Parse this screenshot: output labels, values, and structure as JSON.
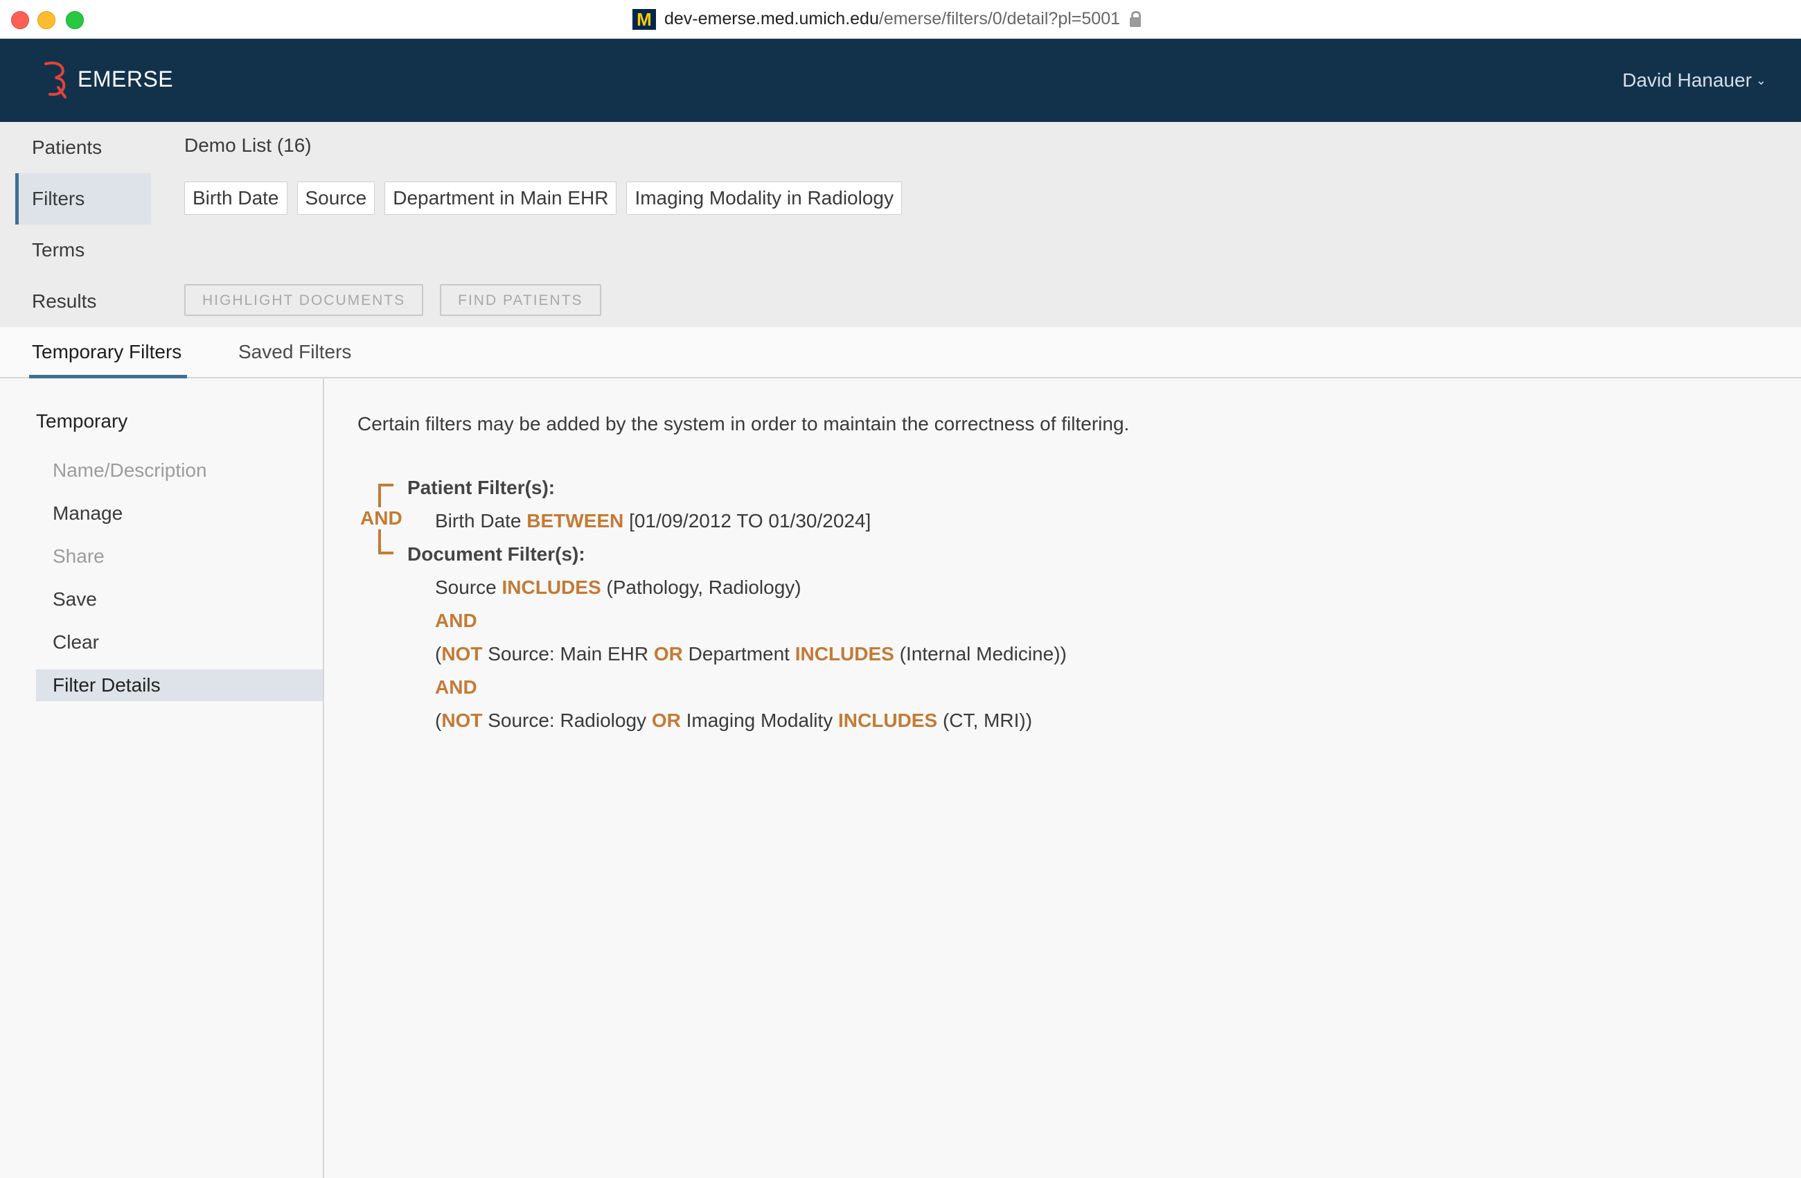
{
  "browser": {
    "url_host": "dev-emerse.med.umich.edu",
    "url_path": "/emerse/filters/0/detail?pl=5001",
    "site_badge": "M"
  },
  "header": {
    "app_name": "EMERSE",
    "user_name": "David Hanauer",
    "user_chevron": "⌄"
  },
  "nav": {
    "items": [
      {
        "label": "Patients"
      },
      {
        "label": "Filters"
      },
      {
        "label": "Terms"
      },
      {
        "label": "Results"
      }
    ]
  },
  "patient_list": {
    "title": "Demo List (16)"
  },
  "filter_chips": [
    "Birth Date",
    "Source",
    "Department in Main EHR",
    "Imaging Modality in Radiology"
  ],
  "actions": {
    "highlight": "HIGHLIGHT DOCUMENTS",
    "find": "FIND PATIENTS"
  },
  "tabs": [
    {
      "label": "Temporary Filters"
    },
    {
      "label": "Saved Filters"
    }
  ],
  "side_menu": {
    "heading": "Temporary",
    "items": [
      {
        "label": "Name/Description"
      },
      {
        "label": "Manage"
      },
      {
        "label": "Share"
      },
      {
        "label": "Save"
      },
      {
        "label": "Clear"
      },
      {
        "label": "Filter Details"
      }
    ]
  },
  "details": {
    "notice": "Certain filters may be added by the system in order to maintain the correctness of filtering.",
    "combiner": "AND",
    "patient_heading": "Patient Filter(s):",
    "patient_field": "Birth Date",
    "patient_op": "BETWEEN",
    "patient_value": "[01/09/2012 TO 01/30/2024]",
    "document_heading": "Document Filter(s):",
    "doc1_field": "Source",
    "doc1_op": "INCLUDES",
    "doc1_value": "(Pathology, Radiology)",
    "join1": "AND",
    "doc2_open": "(",
    "doc2_not": "NOT",
    "doc2_text1": "Source: Main EHR",
    "doc2_or": "OR",
    "doc2_text2": "Department",
    "doc2_op": "INCLUDES",
    "doc2_value": "(Internal Medicine))",
    "join2": "AND",
    "doc3_open": "(",
    "doc3_not": "NOT",
    "doc3_text1": "Source: Radiology",
    "doc3_or": "OR",
    "doc3_text2": "Imaging Modality",
    "doc3_op": "INCLUDES",
    "doc3_value": "(CT, MRI))"
  }
}
